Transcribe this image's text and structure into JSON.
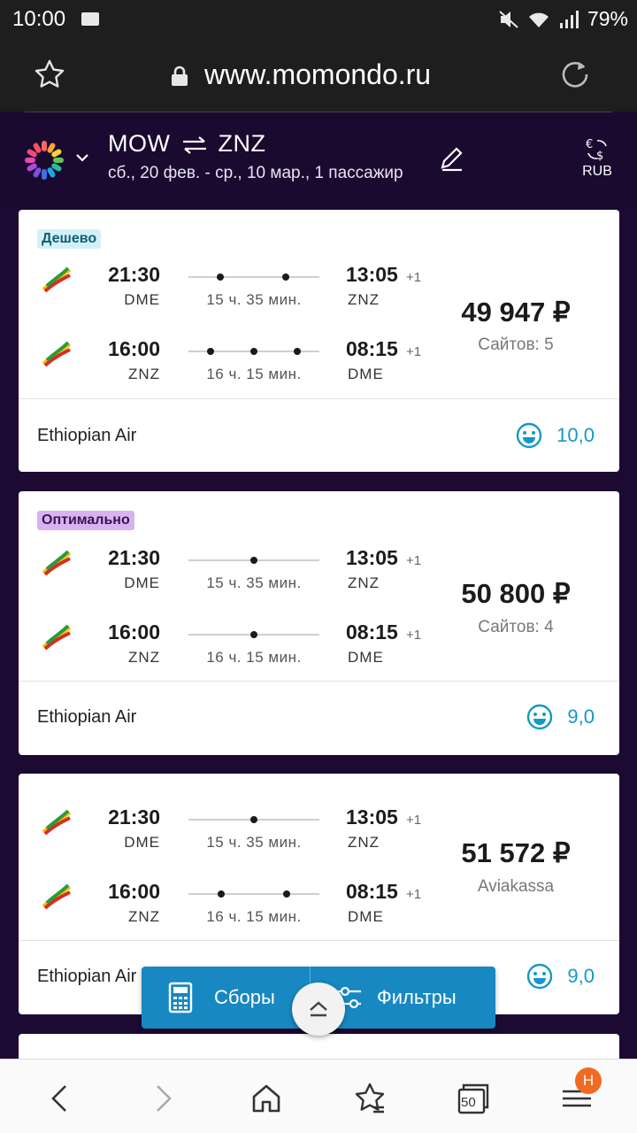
{
  "status_bar": {
    "time": "10:00",
    "battery": "79%"
  },
  "browser": {
    "url": "www.momondo.ru"
  },
  "search": {
    "origin": "MOW",
    "destination": "ZNZ",
    "dates": "сб., 20 фев. - ср., 10 мар., 1 пассажир",
    "currency": "RUB"
  },
  "results": [
    {
      "badge": "Дешево",
      "badge_type": "cheap",
      "legs": [
        {
          "dep_time": "21:30",
          "dep_code": "DME",
          "duration": "15 ч. 35 мин.",
          "arr_time": "13:05",
          "arr_code": "ZNZ",
          "day_offset": "+1",
          "stops": 2
        },
        {
          "dep_time": "16:00",
          "dep_code": "ZNZ",
          "duration": "16 ч. 15 мин.",
          "arr_time": "08:15",
          "arr_code": "DME",
          "day_offset": "+1",
          "stops": 3
        }
      ],
      "price": "49 947 ₽",
      "sites": "Сайтов: 5",
      "airline": "Ethiopian Air",
      "rating": "10,0"
    },
    {
      "badge": "Оптимально",
      "badge_type": "optimal",
      "legs": [
        {
          "dep_time": "21:30",
          "dep_code": "DME",
          "duration": "15 ч. 35 мин.",
          "arr_time": "13:05",
          "arr_code": "ZNZ",
          "day_offset": "+1",
          "stops": 1
        },
        {
          "dep_time": "16:00",
          "dep_code": "ZNZ",
          "duration": "16 ч. 15 мин.",
          "arr_time": "08:15",
          "arr_code": "DME",
          "day_offset": "+1",
          "stops": 1
        }
      ],
      "price": "50 800 ₽",
      "sites": "Сайтов: 4",
      "airline": "Ethiopian Air",
      "rating": "9,0"
    },
    {
      "badge": "",
      "badge_type": "",
      "legs": [
        {
          "dep_time": "21:30",
          "dep_code": "DME",
          "duration": "15 ч. 35 мин.",
          "arr_time": "13:05",
          "arr_code": "ZNZ",
          "day_offset": "+1",
          "stops": 1
        },
        {
          "dep_time": "16:00",
          "dep_code": "ZNZ",
          "duration": "16 ч. 15 мин.",
          "arr_time": "08:15",
          "arr_code": "DME",
          "day_offset": "+1",
          "stops": 2
        }
      ],
      "price": "51 572 ₽",
      "sites": "Aviakassa",
      "airline": "Ethiopian Air",
      "rating": "9,0"
    }
  ],
  "action_bar": {
    "fees_label": "Сборы",
    "filters_label": "Фильтры"
  },
  "bottom_nav": {
    "tabs_count": "50",
    "notification": "Н"
  },
  "colors": {
    "header_bg": "#1a0a30",
    "accent_blue": "#1788c2",
    "rating_blue": "#1598c8",
    "badge_cheap": "#d4f0f7",
    "badge_optimal": "#d9b3f0"
  }
}
